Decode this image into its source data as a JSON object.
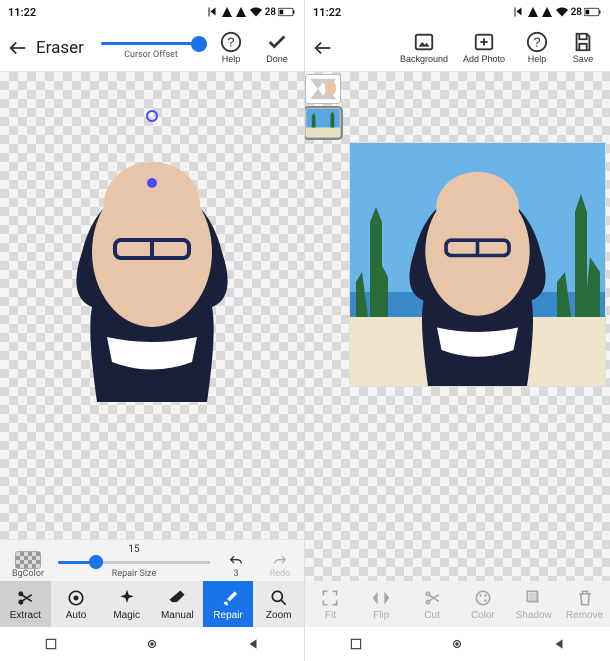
{
  "status": {
    "time": "11:22",
    "battery": "28"
  },
  "left": {
    "title": "Eraser",
    "cursor_offset_label": "Cursor Offset",
    "help_label": "Help",
    "done_label": "Done",
    "repair_panel": {
      "bgcolor_label": "BgColor",
      "size_value": "15",
      "size_label": "Repair Size",
      "undo_count": "3",
      "redo_label": "Redo"
    },
    "tabs": {
      "extract": "Extract",
      "auto": "Auto",
      "magic": "Magic",
      "manual": "Manual",
      "repair": "Repair",
      "zoom": "Zoom"
    }
  },
  "right": {
    "toolbar": {
      "background": "Background",
      "add_photo": "Add Photo",
      "help": "Help",
      "save": "Save"
    },
    "tabs": {
      "fit": "Fit",
      "flip": "Flip",
      "cut": "Cut",
      "color": "Color",
      "shadow": "Shadow",
      "remove": "Remove"
    }
  }
}
